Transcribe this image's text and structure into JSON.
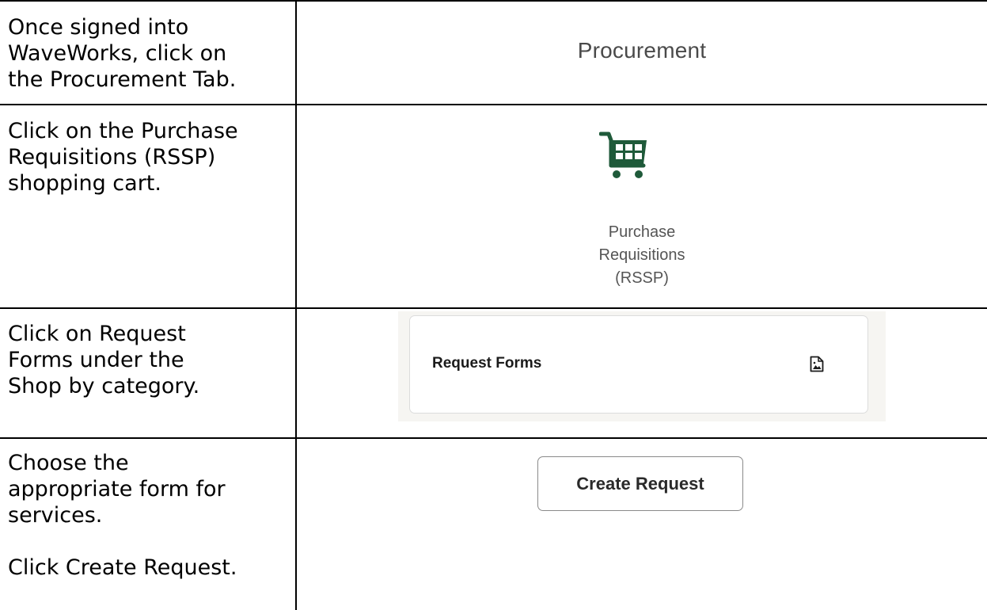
{
  "steps": [
    {
      "instruction": "Once signed into\nWaveWorks, click on\nthe Procurement Tab.",
      "procurement_tab_label": "Procurement"
    },
    {
      "instruction": "Click on the Purchase\nRequisitions (RSSP)\nshopping cart.",
      "cart_icon": "shopping-cart-icon",
      "cart_label_lines": [
        "Purchase",
        "Requisitions",
        "(RSSP)"
      ]
    },
    {
      "instruction": "Click on Request\nForms under the\nShop by category.",
      "card_title": "Request Forms",
      "card_icon": "document-image-icon"
    },
    {
      "instruction": "Choose the\nappropriate form for\nservices.\n\nClick Create Request.",
      "button_label": "Create Request"
    }
  ],
  "colors": {
    "cart_green": "#1f5a3a",
    "label_gray": "#555555",
    "card_band": "#f6f5f2"
  }
}
